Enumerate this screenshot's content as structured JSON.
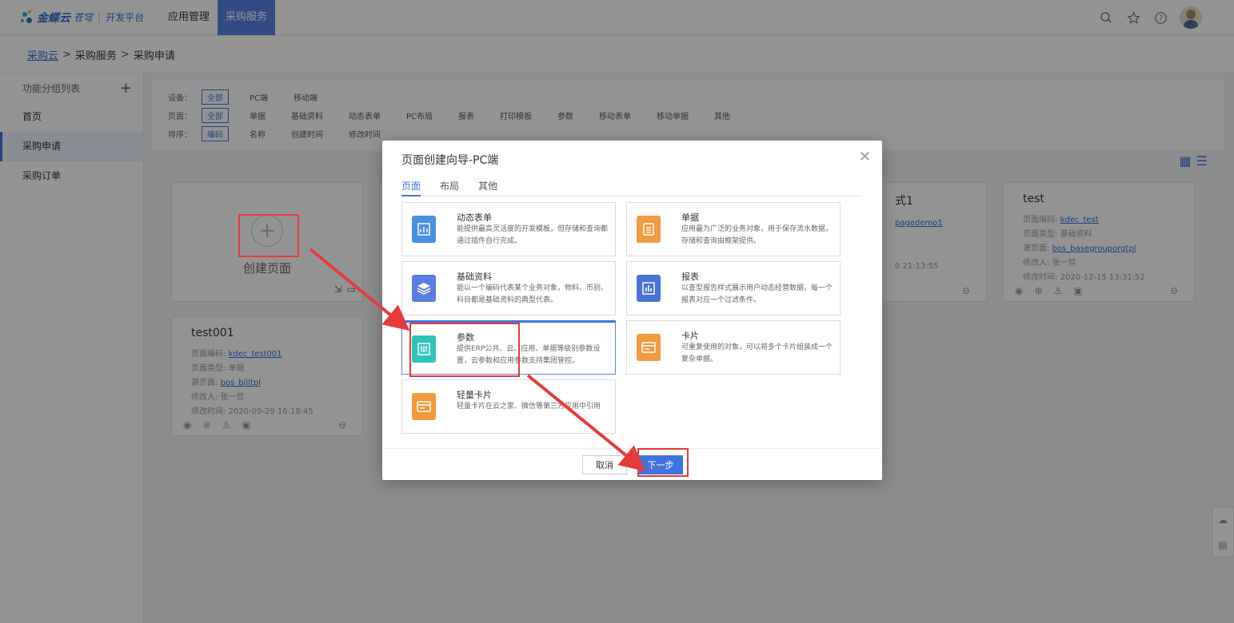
{
  "header": {
    "logo_brand": "金蝶云",
    "logo_sub": "苍穹",
    "logo_platform": "开发平台",
    "nav": [
      {
        "label": "应用管理",
        "active": false
      },
      {
        "label": "采购服务",
        "active": true
      }
    ],
    "tools": [
      "search-icon",
      "star-icon",
      "help-icon",
      "user-avatar"
    ]
  },
  "breadcrumb": {
    "root": "采购云",
    "sep": ">",
    "level2": "采购服务",
    "level3": "采购申请"
  },
  "sidebar": {
    "title": "功能分组列表",
    "add_label": "+",
    "items": [
      {
        "label": "首页",
        "active": false
      },
      {
        "label": "采购申请",
        "active": true
      },
      {
        "label": "采购订单",
        "active": false
      }
    ]
  },
  "filters": {
    "device": {
      "label": "设备：",
      "options": [
        "全部",
        "PC端",
        "移动端"
      ],
      "selected": "全部"
    },
    "page": {
      "label": "页面：",
      "options": [
        "全部",
        "单据",
        "基础资料",
        "动态表单",
        "PC布局",
        "报表",
        "打印模板",
        "参数",
        "移动表单",
        "移动单据",
        "其他"
      ],
      "selected": "全部"
    },
    "sort": {
      "label": "排序：",
      "options": [
        "编码",
        "名称",
        "创建时间",
        "修改时间"
      ],
      "selected": "编码"
    }
  },
  "cards": {
    "create_label": "创建页面",
    "partial_title": "式1",
    "partial_link": "pagedemo1",
    "partial_time": "0 21:13:55",
    "test": {
      "title": "test",
      "code_label": "页面编码:",
      "code": "kdec_test",
      "type_label": "页面类型:",
      "type": "基础资料",
      "source_label": "源页面:",
      "source": "bos_basegrouporgtpl",
      "modifier_label": "修改人:",
      "modifier": "张一哲",
      "time_label": "修改时间:",
      "time": "2020-12-15 13:31:52"
    },
    "test001": {
      "title": "test001",
      "code_label": "页面编码:",
      "code": "kdec_test001",
      "type_label": "页面类型:",
      "type": "单据",
      "source_label": "源页面:",
      "source": "bos_billtpl",
      "modifier_label": "修改人:",
      "modifier": "张一哲",
      "time_label": "修改时间:",
      "time": "2020-09-29 16:18:45"
    }
  },
  "modal": {
    "title": "页面创建向导-PC端",
    "tabs": [
      {
        "label": "页面",
        "active": true
      },
      {
        "label": "布局",
        "active": false
      },
      {
        "label": "其他",
        "active": false
      }
    ],
    "tiles": [
      {
        "name": "动态表单",
        "desc": "能提供最高灵活度的开发模板，但存储和查询都通过插件自行完成。",
        "icon": "dynamic-form-icon",
        "color": "#4a8fe6"
      },
      {
        "name": "单据",
        "desc": "应用最为广泛的业务对象，用于保存流水数据，存储和查询由框架提供。",
        "icon": "bill-icon",
        "color": "#f19a3e"
      },
      {
        "name": "基础资料",
        "desc": "能以一个编码代表某个业务对象，物料、币别、科目都是基础资料的典型代表。",
        "icon": "layers-icon",
        "color": "#5a7fe0"
      },
      {
        "name": "报表",
        "desc": "以查型报告样式展示用户动态经营数据，每一个报表对应一个过滤条件。",
        "icon": "report-icon",
        "color": "#4a73d6"
      },
      {
        "name": "参数",
        "desc": "提供ERP公共、云、应用、单据等级别参数设置，云参数和应用参数支持集团管控。",
        "icon": "parameter-icon",
        "color": "#2ec4bc"
      },
      {
        "name": "卡片",
        "desc": "可重复使用的对象，可以将多个卡片组装成一个复杂单据。",
        "icon": "card-icon",
        "color": "#f19a3e"
      },
      {
        "name": "轻量卡片",
        "desc": "轻量卡片在云之家、微信等第三方应用中引用",
        "icon": "light-card-icon",
        "color": "#f19a3e"
      }
    ],
    "selected_tile": "参数",
    "cancel_label": "取消",
    "next_label": "下一步",
    "close_icon": "close-icon"
  }
}
